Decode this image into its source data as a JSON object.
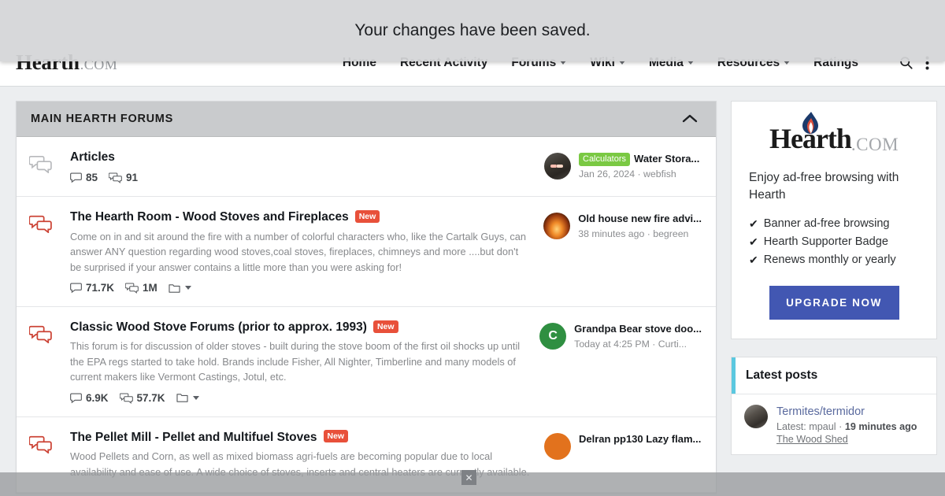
{
  "notice": {
    "text": "Your changes have been saved."
  },
  "header": {
    "brand_main": "Hearth",
    "brand_suffix": ".COM",
    "nav": [
      {
        "label": "Home",
        "has_caret": false
      },
      {
        "label": "Recent Activity",
        "has_caret": false
      },
      {
        "label": "Forums",
        "has_caret": true
      },
      {
        "label": "Wiki",
        "has_caret": true
      },
      {
        "label": "Media",
        "has_caret": true
      },
      {
        "label": "Resources",
        "has_caret": true
      },
      {
        "label": "Ratings",
        "has_caret": false
      }
    ],
    "icons": {
      "search": "search-icon",
      "more": "vertical-dots-icon"
    }
  },
  "forum_section": {
    "title": "MAIN HEARTH FORUMS",
    "collapse_icon": "chevron-up-icon",
    "nodes": [
      {
        "title": "Articles",
        "new": "",
        "description": "",
        "threads": "85",
        "messages": "91",
        "read_state": "read",
        "has_watch": false,
        "latest": {
          "prefix": "Calculators",
          "title": "Water Stora...",
          "meta": "Jan 26, 2024 · webfish",
          "avatar": "photo-dark"
        }
      },
      {
        "title": "The Hearth Room - Wood Stoves and Fireplaces",
        "new": "New",
        "description": "Come on in and sit around the fire with a number of colorful characters who, like the Cartalk Guys, can answer ANY question regarding wood stoves,coal stoves, fireplaces, chimneys and more ....but don't be surprised if your answer contains a little more than you were asking for!",
        "threads": "71.7K",
        "messages": "1M",
        "read_state": "unread",
        "has_watch": true,
        "latest": {
          "prefix": "",
          "title": "Old house new fire advi...",
          "meta": "38 minutes ago · begreen",
          "avatar": "flame"
        }
      },
      {
        "title": "Classic Wood Stove Forums (prior to approx. 1993)",
        "new": "New",
        "description": "This forum is for discussion of older stoves - built during the stove boom of the first oil shocks up until the EPA regs started to take hold. Brands include Fisher, All Nighter, Timberline and many models of current makers like Vermont Castings, Jotul, etc.",
        "threads": "6.9K",
        "messages": "57.7K",
        "read_state": "unread",
        "has_watch": true,
        "latest": {
          "prefix": "",
          "title": "Grandpa Bear stove doo...",
          "meta": "Today at 4:25 PM · Curti...",
          "avatar": "green",
          "avatar_letter": "C"
        }
      },
      {
        "title": "The Pellet Mill - Pellet and Multifuel Stoves",
        "new": "New",
        "description": "Wood Pellets and Corn, as well as mixed biomass agri-fuels are becoming popular due to local availability and ease of use. A wide choice of stoves, inserts and central heaters are currently available.",
        "threads": "",
        "messages": "",
        "read_state": "unread",
        "has_watch": true,
        "latest": {
          "prefix": "",
          "title": "Delran pp130 Lazy flam...",
          "meta": "",
          "avatar": "orange"
        }
      }
    ]
  },
  "sidebar": {
    "ad": {
      "logo_main": "Hearth",
      "logo_suffix": ".COM",
      "headline": "Enjoy ad-free browsing with Hearth",
      "features": [
        "Banner ad-free browsing",
        "Hearth Supporter Badge",
        "Renews monthly or yearly"
      ],
      "check_glyph": "✔",
      "button_label": "UPGRADE NOW",
      "button_color": "#4257b2"
    },
    "latest_posts": {
      "title": "Latest posts",
      "accent_color": "#5bc8e0",
      "items": [
        {
          "title": "Termites/termidor",
          "meta_prefix": "Latest: mpaul · ",
          "meta_time": "19 minutes ago",
          "node": "The Wood Shed",
          "avatar": "photo"
        }
      ]
    }
  },
  "overlay": {
    "close_glyph": "✕"
  },
  "colors": {
    "page_bg": "#eceef0",
    "block_header_bg": "#c9cbcd",
    "badge_new": "#e8503a",
    "prefix_badge": "#7ac943",
    "unread_icon": "#cc4436",
    "read_icon": "#b7b9bc"
  }
}
